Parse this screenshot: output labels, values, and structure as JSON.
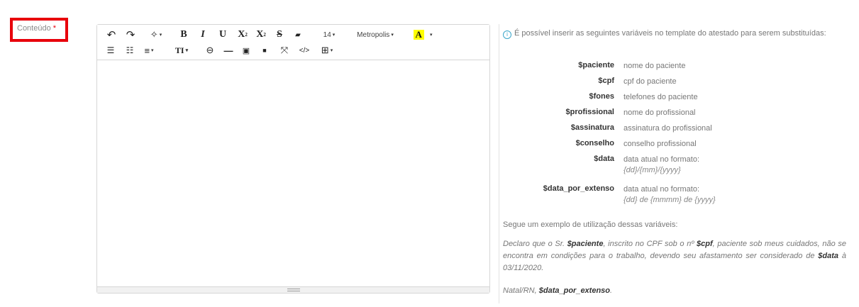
{
  "field": {
    "label": "Conteúdo",
    "required_mark": "*"
  },
  "toolbar": {
    "undo": "↶",
    "redo": "↷",
    "magic": "✧",
    "bold": "B",
    "italic": "I",
    "underline": "U",
    "superscript": "X",
    "subscript": "X",
    "strikethrough": "S",
    "eraser": "▰",
    "font_size": "14",
    "font_name": "Metropolis",
    "highlight": "A",
    "ul": "☰",
    "ol": "☷",
    "align": "≡",
    "text_size": "TI",
    "link": "⊖",
    "hr": "—",
    "image": "▣",
    "video": "■",
    "fullscreen": "⤧",
    "code": "</>",
    "table": "⊞"
  },
  "info": {
    "intro": "É possível inserir as seguintes variáveis no template do atestado para serem substituídas:",
    "variables": [
      {
        "name": "$paciente",
        "desc": "nome do paciente"
      },
      {
        "name": "$cpf",
        "desc": "cpf do paciente"
      },
      {
        "name": "$fones",
        "desc": "telefones do paciente"
      },
      {
        "name": "$profissional",
        "desc": "nome do profissional"
      },
      {
        "name": "$assinatura",
        "desc": "assinatura do profissional"
      },
      {
        "name": "$conselho",
        "desc": "conselho profissional"
      },
      {
        "name": "$data",
        "desc": "data atual no formato:",
        "format": "{dd}/{mm}/{yyyy}"
      },
      {
        "name": "$data_por_extenso",
        "desc": "data atual no formato:",
        "format": "{dd} de {mmmm} de {yyyy}"
      }
    ],
    "example_title": "Segue um exemplo de utilização dessas variáveis:",
    "example": {
      "p1": "Declaro que o Sr. ",
      "v1": "$paciente",
      "p2": ", inscrito no CPF sob o nº ",
      "v2": "$cpf",
      "p3": ", paciente sob meus cuidados, não se encontra em condições para o trabalho, devendo seu afastamento ser considerado de ",
      "v3": "$data",
      "p4": " à 03/11/2020."
    },
    "sign": {
      "prefix": "Natal/RN, ",
      "var": "$data_por_extenso",
      "suffix": "."
    }
  }
}
